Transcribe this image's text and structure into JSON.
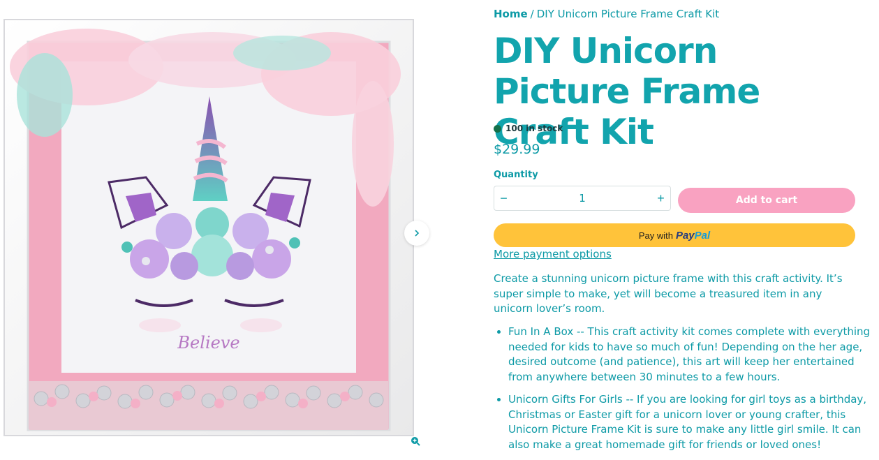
{
  "breadcrumb": {
    "home": "Home",
    "separator": "/",
    "current": "DIY Unicorn Picture Frame Craft Kit"
  },
  "product": {
    "title": "DIY Unicorn Picture Frame Craft Kit",
    "stock": "100 in stock",
    "price": "$29.99",
    "image_caption": "Believe"
  },
  "quantity": {
    "label": "Quantity",
    "value": "1",
    "minus": "−",
    "plus": "+"
  },
  "buttons": {
    "add_to_cart": "Add to cart",
    "paypal_prefix": "Pay with",
    "paypal_pay": "Pay",
    "paypal_pal": "Pal",
    "more_payment": "More payment options"
  },
  "description": {
    "intro": "Create a stunning unicorn picture frame with this craft activity. It’s super simple to make, yet will become a treasured item in any unicorn lover’s room.",
    "bullets": [
      "Fun In A Box -- This craft activity kit comes complete with everything needed for kids to have so much of fun! Depending on the her age, desired outcome (and patience), this art will keep her entertained from anywhere between 30 minutes to a few hours.",
      "Unicorn Gifts For Girls -- If you are looking for girl toys as a birthday, Christmas or Easter gift for a unicorn lover or young crafter, this Unicorn Picture Frame Kit is sure to make any little girl smile. It can also make a great homemade gift for friends or loved ones!"
    ]
  },
  "colors": {
    "accent": "#0d9aa6",
    "title": "#12a4ad",
    "add_to_cart": "#f9a2c1",
    "paypal": "#ffc33a",
    "stock_dot": "#15704a"
  },
  "icons": {
    "next": "chevron-right-icon",
    "zoom": "zoom-in-icon",
    "stock": "status-dot-icon"
  }
}
